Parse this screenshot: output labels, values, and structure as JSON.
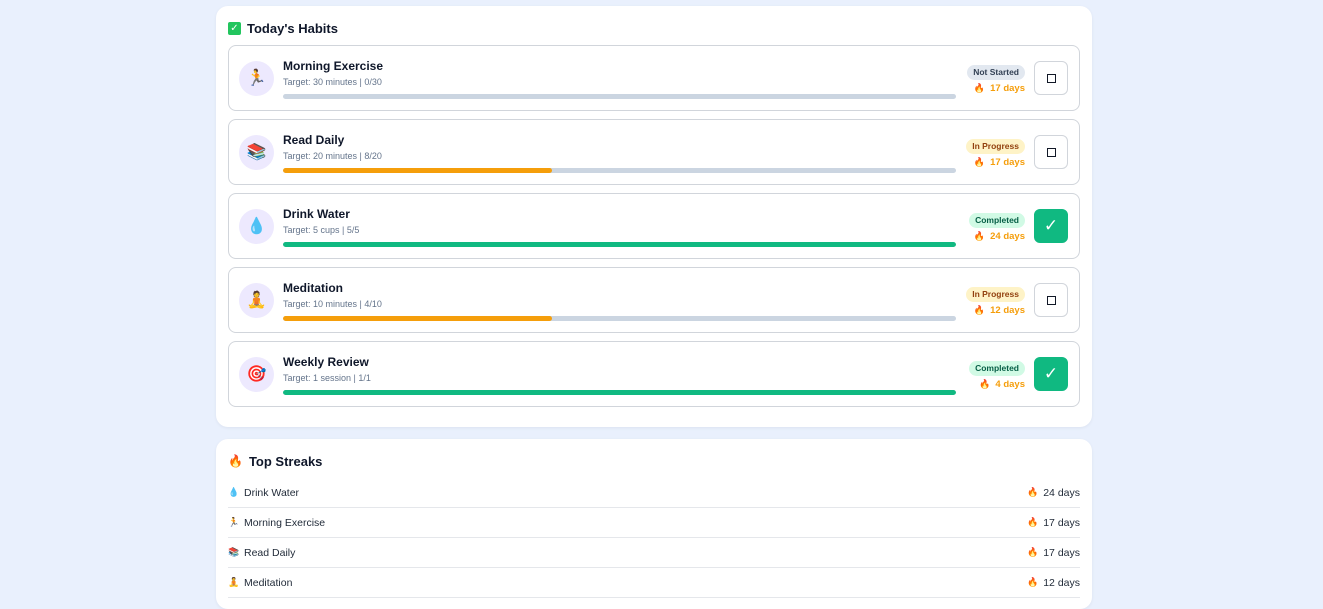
{
  "habits_section": {
    "title": "Today's Habits",
    "habits": [
      {
        "icon": "🏃",
        "icon_name": "running-person-icon",
        "name": "Morning Exercise",
        "target": "Target: 30 minutes | 0/30",
        "progress": 0,
        "status": "Not Started",
        "status_key": "not-started",
        "streak": "17 days",
        "done": false
      },
      {
        "icon": "📚",
        "icon_name": "books-icon",
        "name": "Read Daily",
        "target": "Target: 20 minutes | 8/20",
        "progress": 0.4,
        "status": "In Progress",
        "status_key": "in-progress",
        "streak": "17 days",
        "done": false
      },
      {
        "icon": "💧",
        "icon_name": "water-drop-icon",
        "name": "Drink Water",
        "target": "Target: 5 cups | 5/5",
        "progress": 1,
        "status": "Completed",
        "status_key": "completed",
        "streak": "24 days",
        "done": true
      },
      {
        "icon": "🧘",
        "icon_name": "meditation-icon",
        "name": "Meditation",
        "target": "Target: 10 minutes | 4/10",
        "progress": 0.4,
        "status": "In Progress",
        "status_key": "in-progress",
        "streak": "12 days",
        "done": false
      },
      {
        "icon": "🎯",
        "icon_name": "target-icon",
        "name": "Weekly Review",
        "target": "Target: 1 session | 1/1",
        "progress": 1,
        "status": "Completed",
        "status_key": "completed",
        "streak": "4 days",
        "done": true
      }
    ]
  },
  "streaks_section": {
    "title": "Top Streaks",
    "items": [
      {
        "icon": "💧",
        "icon_name": "water-drop-icon",
        "name": "Drink Water",
        "streak": "24 days"
      },
      {
        "icon": "🏃",
        "icon_name": "running-person-icon",
        "name": "Morning Exercise",
        "streak": "17 days"
      },
      {
        "icon": "📚",
        "icon_name": "books-icon",
        "name": "Read Daily",
        "streak": "17 days"
      },
      {
        "icon": "🧘",
        "icon_name": "meditation-icon",
        "name": "Meditation",
        "streak": "12 days"
      }
    ]
  },
  "colors": {
    "page_bg": "#e9f0fd",
    "progress_in_progress": "#f59e0b",
    "progress_completed": "#10b981",
    "progress_track": "#cbd5e1",
    "streak_text": "#f59e0b",
    "done_button": "#10b981"
  },
  "icons": {
    "check": "✓",
    "fire": "🔥",
    "title_check": "✓"
  }
}
